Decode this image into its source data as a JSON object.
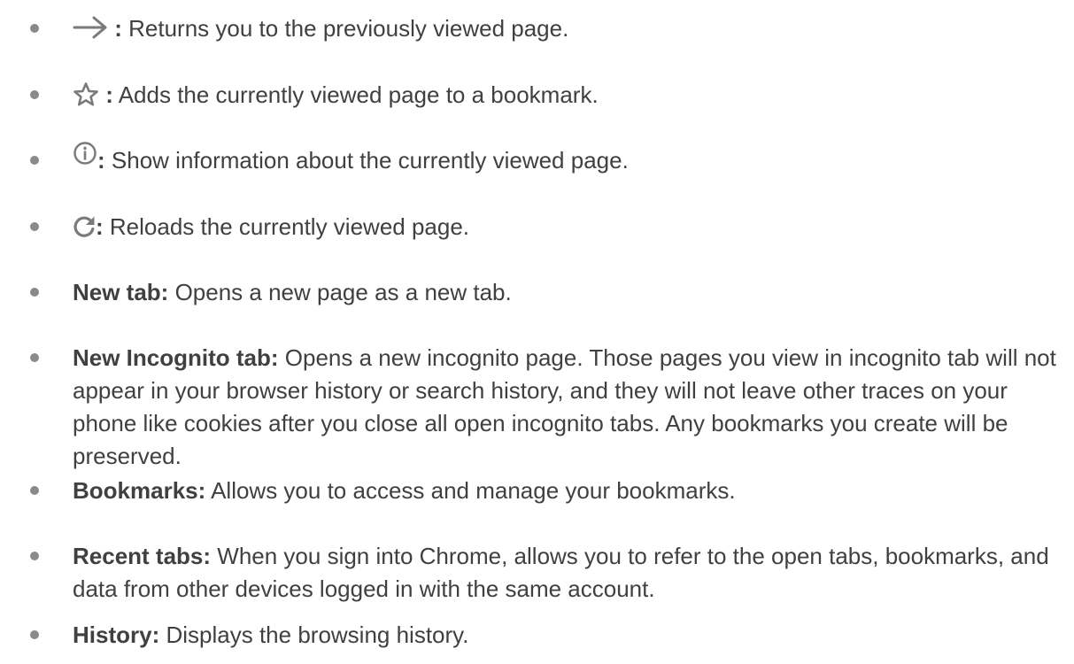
{
  "items": [
    {
      "icon": "forward-arrow-icon",
      "separator": ":",
      "description": "Returns you to the previously viewed page."
    },
    {
      "icon": "star-outline-icon",
      "separator": ":",
      "description": "Adds the currently viewed page to a bookmark."
    },
    {
      "icon": "info-circle-icon",
      "separator": ":",
      "description": "Show information about the currently viewed page."
    },
    {
      "icon": "reload-icon",
      "separator": ":",
      "description": "Reloads the currently viewed page."
    },
    {
      "term": "New tab:",
      "description": "Opens a new page as a new tab."
    },
    {
      "term": "New Incognito tab:",
      "description": "Opens a new incognito page. Those pages you view in incognito tab will not appear in your browser history or search history, and they will not leave other traces on your phone like cookies after you close all open incognito tabs. Any bookmarks you create will be preserved."
    },
    {
      "term": "Bookmarks:",
      "description": "Allows you to access and manage your bookmarks."
    },
    {
      "term": "Recent tabs:",
      "description": "When you sign into Chrome, allows you to refer to the open tabs, bookmarks, and data from other devices logged in with the same account."
    },
    {
      "term": "History:",
      "description": "Displays the browsing history."
    }
  ],
  "colors": {
    "text": "#404040",
    "icon": "#7a7a7a",
    "bullet": "#8a8a8a"
  }
}
